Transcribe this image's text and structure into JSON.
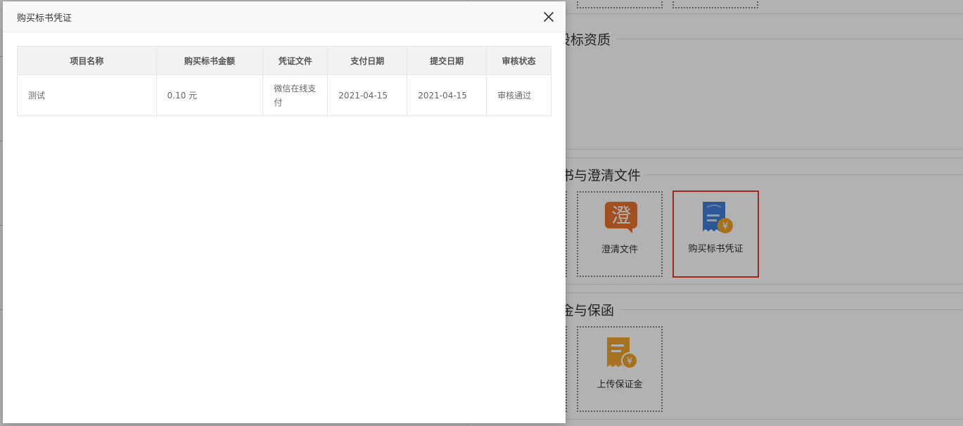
{
  "background": {
    "sections": [
      {
        "title": "投标资质",
        "visible_title": "设标资质"
      },
      {
        "title": "标书与澄清文件",
        "visible_title": "书与澄清文件"
      },
      {
        "title": "保证金与保函",
        "visible_title": "金与保函"
      }
    ],
    "tiles": {
      "clarify": {
        "label": "澄清文件",
        "icon_char": "澄"
      },
      "voucher": {
        "label": "购买标书凭证"
      },
      "deposit": {
        "label": "上传保证金"
      }
    }
  },
  "modal": {
    "title": "购买标书凭证",
    "table": {
      "headers": [
        "项目名称",
        "购买标书金额",
        "凭证文件",
        "支付日期",
        "提交日期",
        "审核状态"
      ],
      "rows": [
        [
          "测试",
          "0.10 元",
          "微信在线支付",
          "2021-04-15",
          "2021-04-15",
          "审核通过"
        ]
      ]
    }
  },
  "colors": {
    "selected_border": "#e53935",
    "clarify_icon": "#e8732d",
    "voucher_icon": "#3f7fd6",
    "coin": "#f0a42c",
    "deposit_icon": "#f0a42c"
  }
}
